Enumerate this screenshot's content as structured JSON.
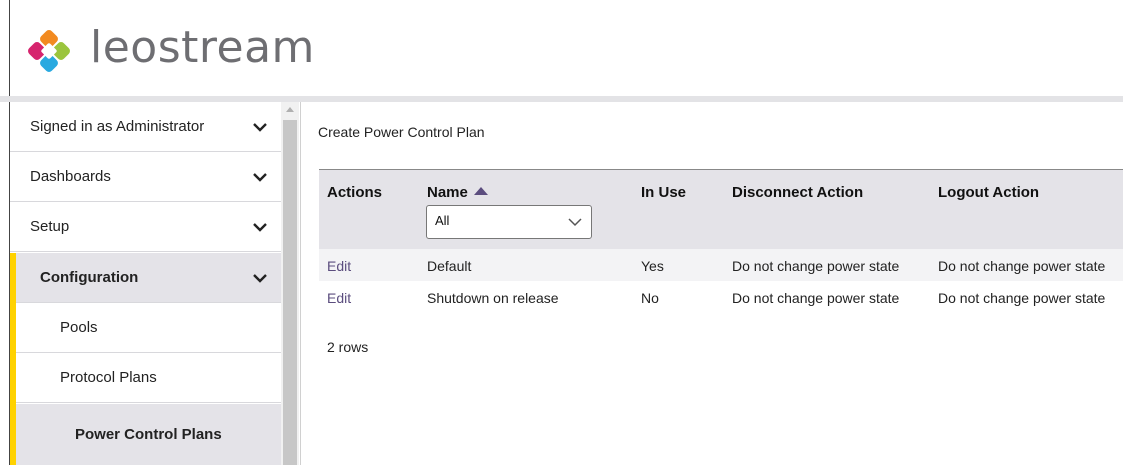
{
  "brand": {
    "name": "leostream"
  },
  "sidebar": {
    "items": [
      {
        "label": "Signed in as Administrator"
      },
      {
        "label": "Dashboards"
      },
      {
        "label": "Setup"
      },
      {
        "label": "Configuration"
      },
      {
        "label": "Pools"
      },
      {
        "label": "Protocol Plans"
      },
      {
        "label": "Power Control Plans"
      }
    ]
  },
  "main": {
    "create_link": "Create Power Control Plan",
    "table": {
      "headers": [
        "Actions",
        "Name",
        "In Use",
        "Disconnect Action",
        "Logout Action"
      ],
      "name_filter": "All",
      "rows": [
        {
          "action": "Edit",
          "name": "Default",
          "in_use": "Yes",
          "disconnect": "Do not change power state",
          "logout": "Do not change power state"
        },
        {
          "action": "Edit",
          "name": "Shutdown on release",
          "in_use": "No",
          "disconnect": "Do not change power state",
          "logout": "Do not change power state"
        }
      ]
    },
    "row_count": "2 rows"
  },
  "colors": {
    "accent": "#ffd200",
    "link": "#5b4d7e",
    "header_bg": "#e4e3e8"
  }
}
